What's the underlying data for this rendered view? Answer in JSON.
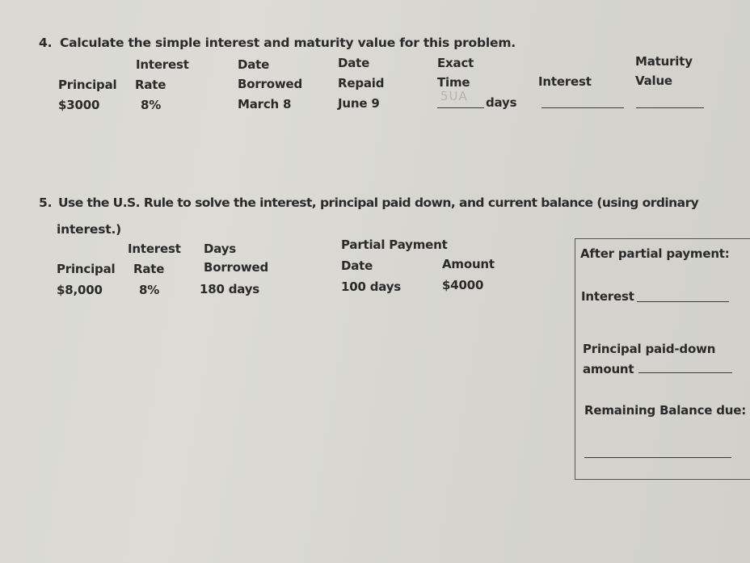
{
  "problem4": {
    "number": "4.",
    "prompt": "Calculate the simple interest and maturity value for this problem.",
    "headers": {
      "principal": "Principal",
      "rate_line1": "Interest",
      "rate_line2": "Rate",
      "borrowed_line1": "Date",
      "borrowed_line2": "Borrowed",
      "repaid_line1": "Date",
      "repaid_line2": "Repaid",
      "time_line1": "Exact",
      "time_line2": "Time",
      "interest": "Interest",
      "maturity_line1": "Maturity",
      "maturity_line2": "Value"
    },
    "values": {
      "principal": "$3000",
      "rate": "8%",
      "date_borrowed": "March 8",
      "date_repaid": "June 9",
      "time_handwritten": "5UA",
      "time_unit": "days"
    }
  },
  "problem5": {
    "number": "5.",
    "prompt_line1": "Use the U.S. Rule to solve the interest, principal paid down, and current balance (using ordinary",
    "prompt_line2": "interest.)",
    "headers": {
      "principal": "Principal",
      "rate_line1": "Interest",
      "rate_line2": "Rate",
      "days_line1": "Days",
      "days_line2": "Borrowed",
      "partial_payment": "Partial  Payment",
      "date": "Date",
      "amount": "Amount"
    },
    "values": {
      "principal": "$8,000",
      "rate": "8%",
      "days_borrowed": "180 days",
      "payment_date": "100 days",
      "payment_amount": "$4000"
    },
    "box": {
      "title": "After partial payment:",
      "interest_label": "Interest",
      "principal_paid_line1": "Principal paid-down",
      "principal_paid_line2": "amount",
      "remaining_label": "Remaining Balance due:"
    }
  }
}
